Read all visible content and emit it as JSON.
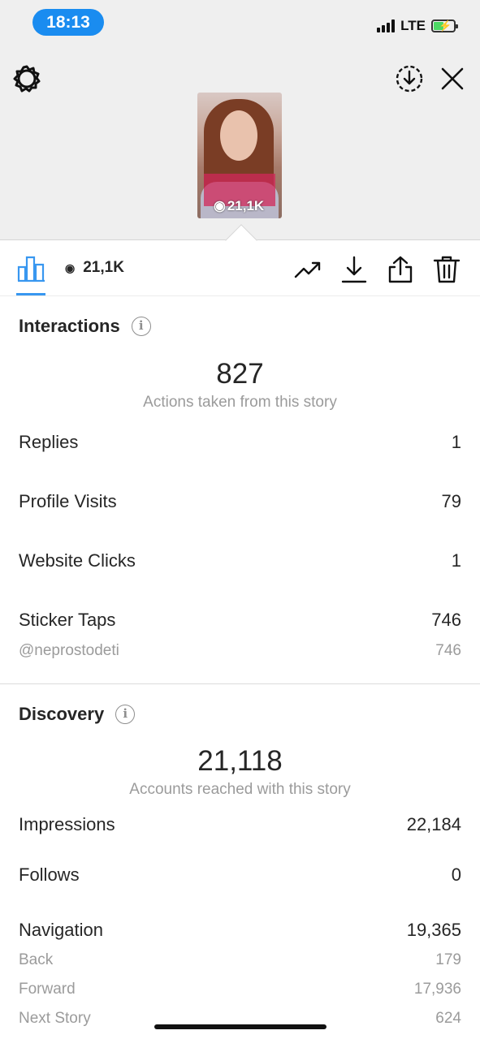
{
  "status_bar": {
    "time": "18:13",
    "network": "LTE"
  },
  "story_preview": {
    "views_overlay": "21,1K"
  },
  "toolbar": {
    "views": "21,1K"
  },
  "interactions": {
    "title": "Interactions",
    "total": "827",
    "total_label": "Actions taken from this story",
    "rows": [
      {
        "label": "Replies",
        "value": "1"
      },
      {
        "label": "Profile Visits",
        "value": "79"
      },
      {
        "label": "Website Clicks",
        "value": "1"
      },
      {
        "label": "Sticker Taps",
        "value": "746"
      }
    ],
    "sticker_sub": {
      "label": "@neprostodeti",
      "value": "746"
    }
  },
  "discovery": {
    "title": "Discovery",
    "total": "21,118",
    "total_label": "Accounts reached with this story",
    "rows": [
      {
        "label": "Impressions",
        "value": "22,184"
      },
      {
        "label": "Follows",
        "value": "0"
      },
      {
        "label": "Navigation",
        "value": "19,365"
      }
    ],
    "navigation_sub": [
      {
        "label": "Back",
        "value": "179"
      },
      {
        "label": "Forward",
        "value": "17,936"
      },
      {
        "label": "Next Story",
        "value": "624"
      }
    ]
  },
  "colors": {
    "status_pill": "#1a8cf0",
    "accent": "#3897f0",
    "muted_text": "#9b9b9b",
    "header_bg": "#efefef"
  }
}
